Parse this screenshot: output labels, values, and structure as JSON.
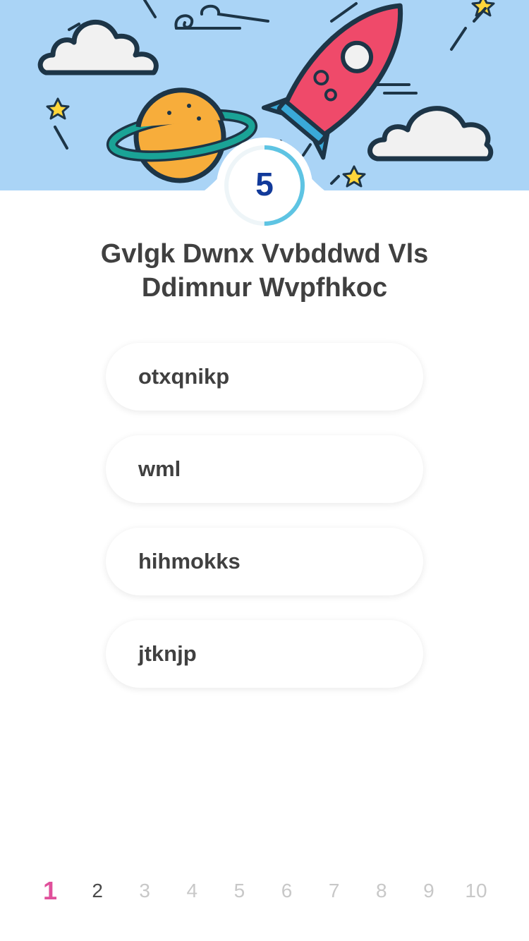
{
  "timer": {
    "value": "5",
    "progress": 0.5,
    "accent": "#5ec4e3"
  },
  "question": {
    "line1": "Gvlgk Dwnx Vvbddwd Vls",
    "line2": "Ddimnur Wvpfhkoc"
  },
  "answers": [
    {
      "label": "otxqnikp"
    },
    {
      "label": "wml"
    },
    {
      "label": "hihmokks"
    },
    {
      "label": "jtknjp"
    }
  ],
  "pager": {
    "current": 1,
    "pages": [
      "1",
      "2",
      "3",
      "4",
      "5",
      "6",
      "7",
      "8",
      "9",
      "10"
    ],
    "active_color": "#e0509b"
  },
  "colors": {
    "sky": "#aad4f6",
    "rocket": "#ef4a6a",
    "planet": "#f7ad3b",
    "ring": "#1aa396"
  }
}
